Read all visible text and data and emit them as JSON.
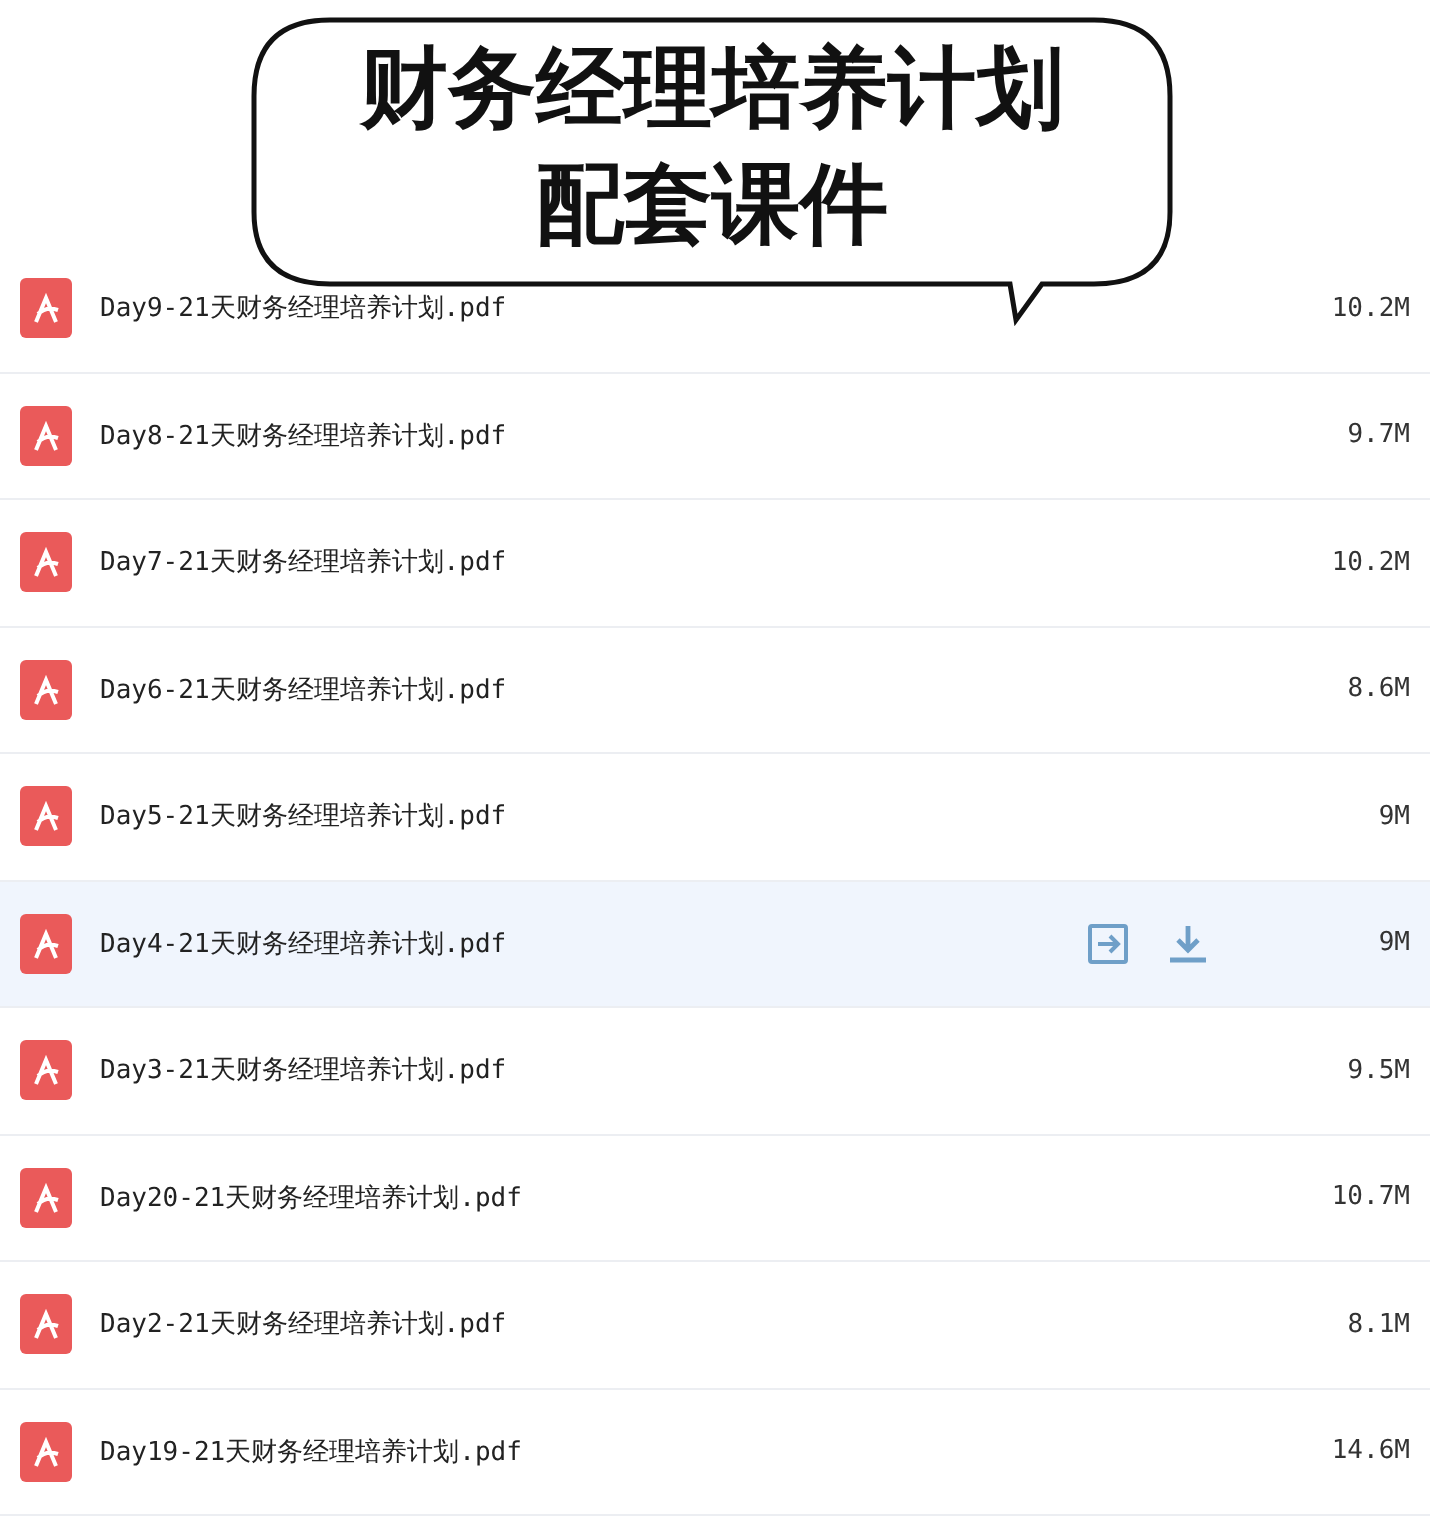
{
  "banner": {
    "lines": [
      "财务经理培养计划",
      "配套课件"
    ]
  },
  "files": [
    {
      "name": "Day9-21天财务经理培养计划.pdf",
      "size": "10.2M",
      "selected": false
    },
    {
      "name": "Day8-21天财务经理培养计划.pdf",
      "size": "9.7M",
      "selected": false
    },
    {
      "name": "Day7-21天财务经理培养计划.pdf",
      "size": "10.2M",
      "selected": false
    },
    {
      "name": "Day6-21天财务经理培养计划.pdf",
      "size": "8.6M",
      "selected": false
    },
    {
      "name": "Day5-21天财务经理培养计划.pdf",
      "size": "9M",
      "selected": false
    },
    {
      "name": "Day4-21天财务经理培养计划.pdf",
      "size": "9M",
      "selected": true
    },
    {
      "name": "Day3-21天财务经理培养计划.pdf",
      "size": "9.5M",
      "selected": false
    },
    {
      "name": "Day20-21天财务经理培养计划.pdf",
      "size": "10.7M",
      "selected": false
    },
    {
      "name": "Day2-21天财务经理培养计划.pdf",
      "size": "8.1M",
      "selected": false
    },
    {
      "name": "Day19-21天财务经理培养计划.pdf",
      "size": "14.6M",
      "selected": false
    }
  ]
}
